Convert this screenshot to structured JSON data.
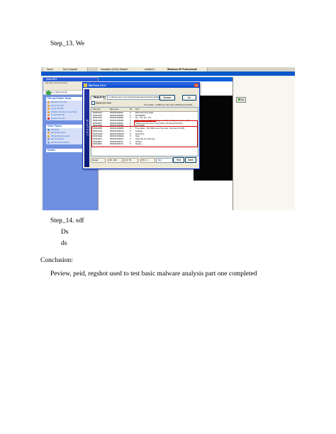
{
  "document": {
    "step13": "Step_13.    We",
    "step14": "Step_14.    sdf",
    "line_ds_upper": "Ds",
    "line_ds_lower": "ds",
    "conclusion_heading": "Conclusion:",
    "conclusion_text": "Peview, peid, regshot used to test basic malware analysis part one completed"
  },
  "screenshot": {
    "taskbar_tabs": [
      "Home",
      "My Computer",
      "Vanadium (2/15) VMware ..",
      "Untitled 2",
      "Windows XP Professional"
    ],
    "explorer": {
      "title": "bintext303",
      "menu": "File  Edit  View  Favorites",
      "address_label": "Address",
      "address_value": "C:\\Documents",
      "tasks_head": "File and Folder Tasks",
      "tasks": [
        "Rename this file",
        "Move this file",
        "Copy this file",
        "Publish this file to the Web",
        "E-mail this file",
        "Delete this file"
      ],
      "places_head": "Other Places",
      "places": [
        "Desktop",
        "My Documents",
        "Shared Documents",
        "My Computer",
        "My Network Places"
      ],
      "details_head": "Details"
    },
    "right_window": {
      "go_label": "Go"
    },
    "bintext": {
      "title": "BinText 3.0.3",
      "logo_text": "BINTEXT",
      "tabs": [
        "Search",
        "Filter",
        "Help"
      ],
      "file_label": "File to scan",
      "file_value": "C:\\Documents and Settings\\Vanadium\\Desktop\\lab01...",
      "browse_label": "Browse",
      "go_label": "Go",
      "advanced_label": "Advanced view",
      "time_info": "Time taken : 0.048 secs   Text size: 5235 bytes (5.11K)",
      "columns": [
        "File pos",
        "Mem pos",
        "ID",
        "Text"
      ],
      "rows": [
        [
          "00004A20",
          "000000404E20",
          "0",
          "Microsoft Corp Switt"
        ],
        [
          "00004A48",
          "000000404E48",
          "0",
          "RICHED32"
        ],
        [
          "00004A60",
          "000000404E60",
          "0",
          "%s : %s, %s - %s."
        ],
        [
          "00004A6D",
          "000000404E6D",
          "0",
          "There was a problem trying to read the string resources in this"
        ],
        [
          "00004A87",
          "000000404E87",
          "0",
          "Please type the text to find before choosing Find Next."
        ],
        [
          "00004A9D",
          "000000404E9D",
          "0",
          "Find What"
        ],
        [
          "00004AB5",
          "000000404EB5",
          "0",
          "Time taken : %d %02u secs   Text size: %u bytes (%.2fK)"
        ],
        [
          "00004AC8",
          "000000404EC8",
          "0",
          "Loading ..."
        ],
        [
          "00004ADD",
          "000000404EDD",
          "0",
          "Scanning..."
        ],
        [
          "00004AEE",
          "000000404EEE",
          "0",
          "Stop"
        ],
        [
          "00004AF4",
          "000000404EF4",
          "0",
          "Open file for scanning"
        ],
        [
          "00004B01",
          "000000404F01",
          "0",
          "All files"
        ],
        [
          "00004B10",
          "000000404F10",
          "0",
          "Saving ..."
        ]
      ],
      "status": [
        "Ready",
        "AN: 239",
        "UN: 59",
        "RS: 0"
      ],
      "find_value": "find",
      "find_button": "Find",
      "save_button": "Save"
    }
  }
}
